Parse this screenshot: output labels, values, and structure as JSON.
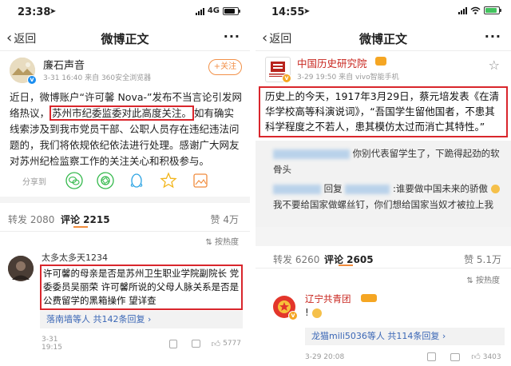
{
  "left": {
    "status": {
      "time": "23:38",
      "network": "4G"
    },
    "nav": {
      "back_label": "返回",
      "title": "微博正文",
      "more_label": "···"
    },
    "post": {
      "author_name": "廉石声音",
      "meta": "3-31 16:40 来自 360安全浏览器",
      "follow_label": "+关注",
      "text_part1": "近日，微博账户“许可馨 Nova-”发布不当言论引发网络热议，",
      "text_highlight": "苏州市纪委监委对此高度关注。",
      "text_part2": "如有确实线索涉及到我市党员干部、公职人员存在违纪违法问题的，我们将依规依纪依法进行处理。感谢广大网友对苏州纪检监察工作的关注关心和积极参与。",
      "share_label": "分享到"
    },
    "tabs": {
      "repost": "转发 2080",
      "comment": "评论 2215",
      "like": "赞 4万"
    },
    "sort_label": "按热度",
    "comment": {
      "user": "太多太多天1234",
      "text": "许可馨的母亲是否是苏州卫生职业学院副院长 党委委员吴丽荣  许可馨所说的父母人脉关系是否是公费留学的黑箱操作  望详查",
      "replies_link": "落南墙等人",
      "replies_count": "共142条回复",
      "date": "3-31 19:15",
      "likes": "5777"
    }
  },
  "right": {
    "status": {
      "time": "14:55"
    },
    "nav": {
      "back_label": "返回",
      "title": "微博正文",
      "more_label": "···"
    },
    "post": {
      "author_name": "中国历史研究院",
      "meta": "3-29 19:50 来自 vivo智能手机",
      "logo_text": "中国历史研究院",
      "text": "历史上的今天，1917年3月29日，蔡元培发表《在清华学校高等科演说词》，“吾国学生留他国者，不患其科学程度之不若人，患其模仿太过而消亡其特性。”"
    },
    "quoted": {
      "line1": "你别代表留学生了，下跪得起劲的软骨头",
      "line2_prefix": "回复",
      "line2": ":谁要做中国未来的骄傲",
      "line2_end": "我不要给国家做螺丝钉，你们想给国家当奴才被拉上我"
    },
    "tabs": {
      "repost": "转发 6260",
      "comment": "评论 2605",
      "like": "赞 5.1万"
    },
    "sort_label": "按热度",
    "comment": {
      "user": "辽宁共青团",
      "text": "!",
      "replies_link": "龙猫mili5036等人",
      "replies_count": "共114条回复",
      "date": "3-29 20:08",
      "likes": "3403"
    }
  },
  "colors": {
    "accent_orange": "#f08b3c",
    "link_blue": "#3b67b6",
    "highlight_red": "#d9262c",
    "brand_red": "#c8251e"
  }
}
